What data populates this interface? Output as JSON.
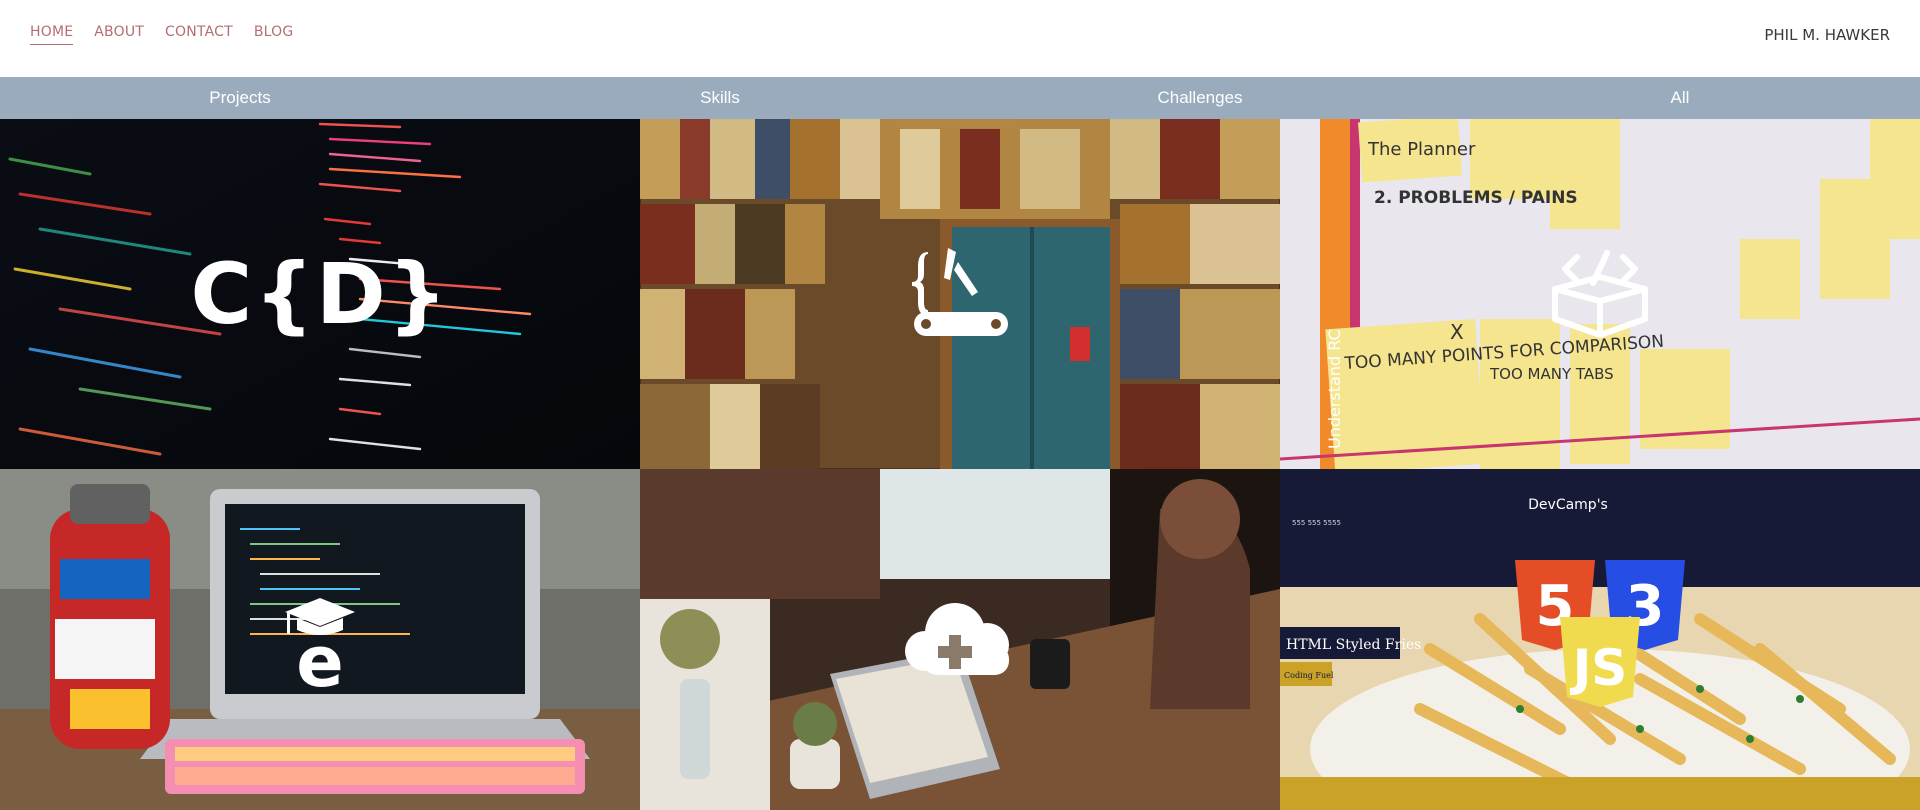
{
  "nav": {
    "items": [
      {
        "label": "HOME",
        "active": true
      },
      {
        "label": "ABOUT",
        "active": false
      },
      {
        "label": "CONTACT",
        "active": false
      },
      {
        "label": "BLOG",
        "active": false
      }
    ],
    "brand": "PHIL M. HAWKER"
  },
  "filters": [
    "Projects",
    "Skills",
    "Challenges",
    "All"
  ],
  "colors": {
    "nav_link": "#b46e73",
    "filter_bar": "#99abbd",
    "brand_text": "#3a3a3a"
  },
  "tiles": [
    {
      "image": "code-on-dark-screen",
      "logo_icon": "code-braces-logo-icon",
      "logo_text": "C{D}"
    },
    {
      "image": "bookshelf-door",
      "logo_icon": "multitool-icon"
    },
    {
      "image": "sticky-notes-whiteboard",
      "logo_icon": "open-box-code-icon",
      "visible_text": {
        "heading": "2. PROBLEMS / PAINS",
        "note1": "TOO MANY POINTS FOR COMPARISON",
        "note2": "TOO MANY TABS",
        "side": "Understand RC",
        "planner": "The Planner",
        "x_mark": "X"
      }
    },
    {
      "image": "laptop-and-water-bottle",
      "logo_icon": "education-e-icon"
    },
    {
      "image": "person-typing-on-laptop",
      "logo_icon": "cloud-plus-icon"
    },
    {
      "image": "html-styled-fries-site",
      "logo_icon": "html-css-js-shields-icon",
      "visible_text": {
        "banner_label": "HTML Styled Fries",
        "button_label": "Coding Fuel",
        "site_name": "DevCamp's",
        "phone": "555 555 5555"
      }
    }
  ]
}
